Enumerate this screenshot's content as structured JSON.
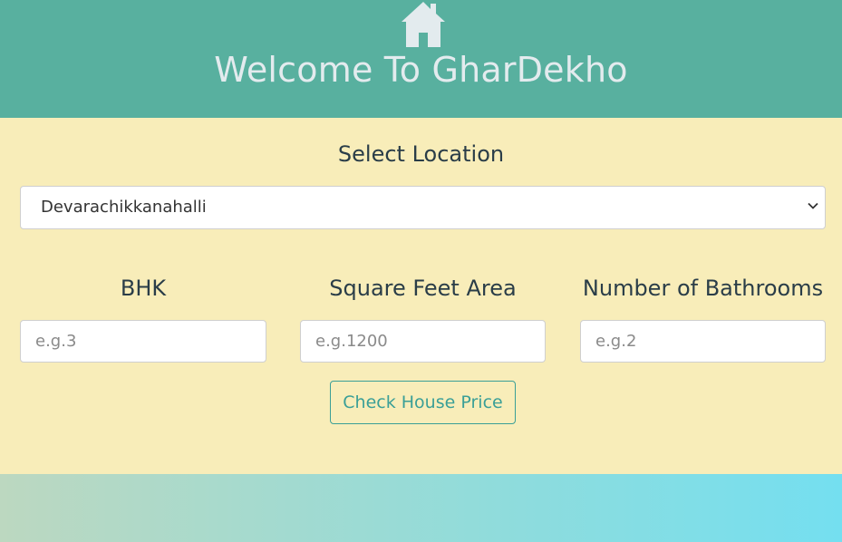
{
  "header": {
    "title": "Welcome To GharDekho",
    "icon": "home-icon",
    "background": "#58b09f"
  },
  "form": {
    "location_label": "Select Location",
    "location_selected": "Devarachikkanahalli",
    "bhk_label": "BHK",
    "bhk_placeholder": "e.g.3",
    "sqft_label": "Square Feet Area",
    "sqft_placeholder": "e.g.1200",
    "bath_label": "Number of Bathrooms",
    "bath_placeholder": "e.g.2",
    "submit_label": "Check House Price",
    "background": "#f8edb9",
    "accent": "#3a9f97"
  }
}
